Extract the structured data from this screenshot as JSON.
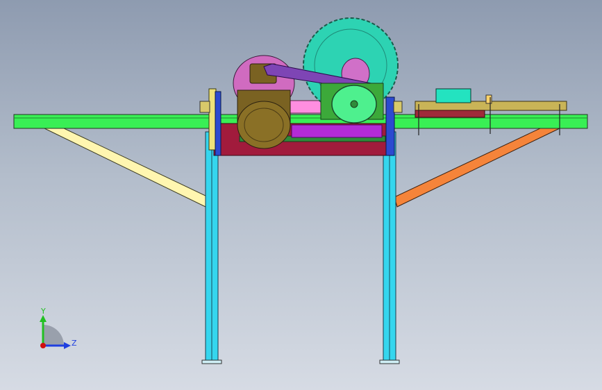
{
  "viewport": {
    "background_top": "#8e9bb0",
    "background_bottom": "#d6dbe4"
  },
  "triad": {
    "y_label": "Y",
    "z_label": "Z",
    "x_color": "#d01010",
    "y_color": "#22c022",
    "z_color": "#1f3fe0"
  },
  "colors": {
    "tabletop": "#39ef55",
    "left_brace": "#fff6b0",
    "right_brace": "#f5843a",
    "legs": "#35d6ee",
    "base_plate": "#a11b3c",
    "motor": "#7a6222",
    "belt": "#7e45b5",
    "blade": "#2dd3b3",
    "pulley": "#4ef08e",
    "guide_bar": "#c9b457",
    "control_box": "#23e3c0"
  }
}
